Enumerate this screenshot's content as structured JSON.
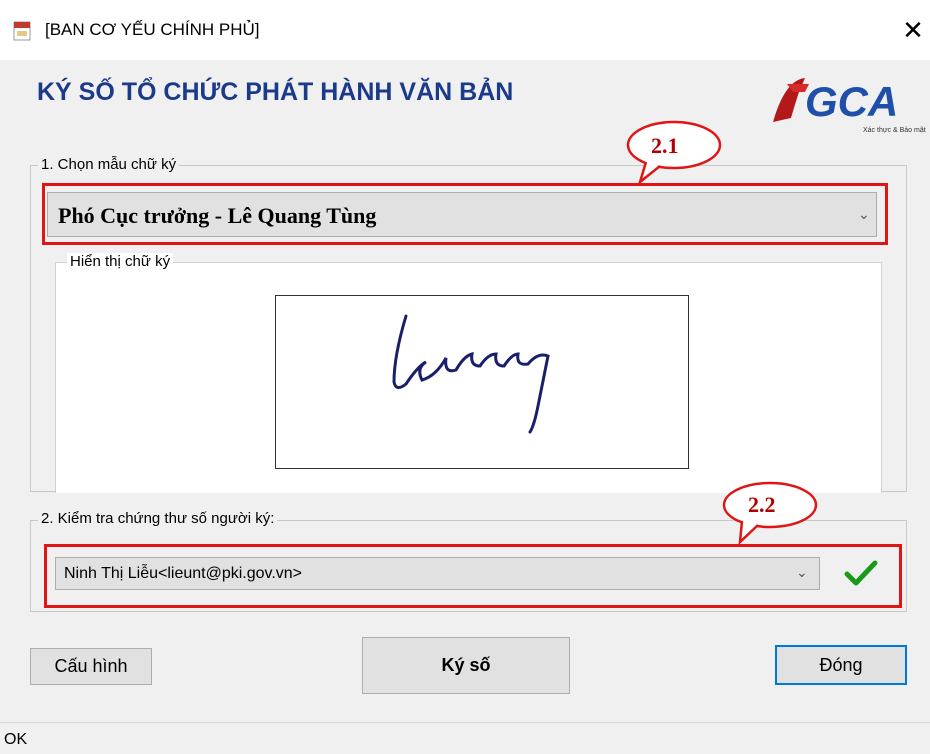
{
  "window": {
    "title": "[BAN CƠ YẾU CHÍNH PHỦ]",
    "close_glyph": "✕"
  },
  "heading": "KÝ SỐ TỔ CHỨC PHÁT HÀNH VĂN BẢN",
  "logo": {
    "text": "GCA",
    "tagline": "Xác thực & Bảo mật"
  },
  "section1": {
    "label": "1. Chọn mẫu chữ ký",
    "selected": "Phó Cục trưởng - Lê Quang Tùng",
    "preview_label": "Hiển thị chữ ký"
  },
  "section2": {
    "label": "2. Kiểm tra chứng thư số người ký:",
    "selected": "Ninh Thị Liễu<lieunt@pki.gov.vn>"
  },
  "callouts": {
    "first": "2.1",
    "second": "2.2"
  },
  "buttons": {
    "config": "Cấu hình",
    "sign": "Ký số",
    "close": "Đóng"
  },
  "status": "OK",
  "colors": {
    "accent": "#1b3a8a",
    "callout": "#e01515",
    "check": "#1a9a1a"
  }
}
